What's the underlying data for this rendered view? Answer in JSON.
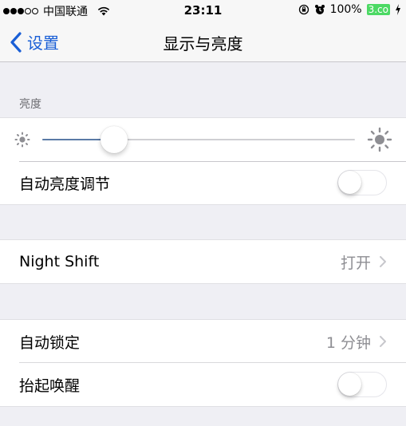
{
  "status_bar": {
    "signal_bars_filled": 3,
    "signal_bars_total": 5,
    "carrier": "中国联通",
    "wifi_icon": "wifi-icon",
    "time": "23:11",
    "orientation_lock_icon": "orientation-lock-icon",
    "alarm_icon": "alarm-icon",
    "battery_percent": "100%",
    "battery_label": "3.co",
    "charging_icon": "charging-bolt-icon"
  },
  "nav": {
    "back_label": "设置",
    "title": "显示与亮度"
  },
  "brightness": {
    "section_header": "亮度",
    "slider_value": 0.23,
    "auto_brightness_label": "自动亮度调节",
    "auto_brightness_on": false
  },
  "night_shift": {
    "label": "Night Shift",
    "value": "打开"
  },
  "lock": {
    "auto_lock_label": "自动锁定",
    "auto_lock_value": "1 分钟",
    "raise_to_wake_label": "抬起唤醒",
    "raise_to_wake_on": false
  },
  "colors": {
    "accent": "#1a5fd6",
    "slider_fill": "#5a7aa6",
    "background": "#efeff4",
    "detail_text": "#8e8e93",
    "battery": "#4cd964"
  }
}
